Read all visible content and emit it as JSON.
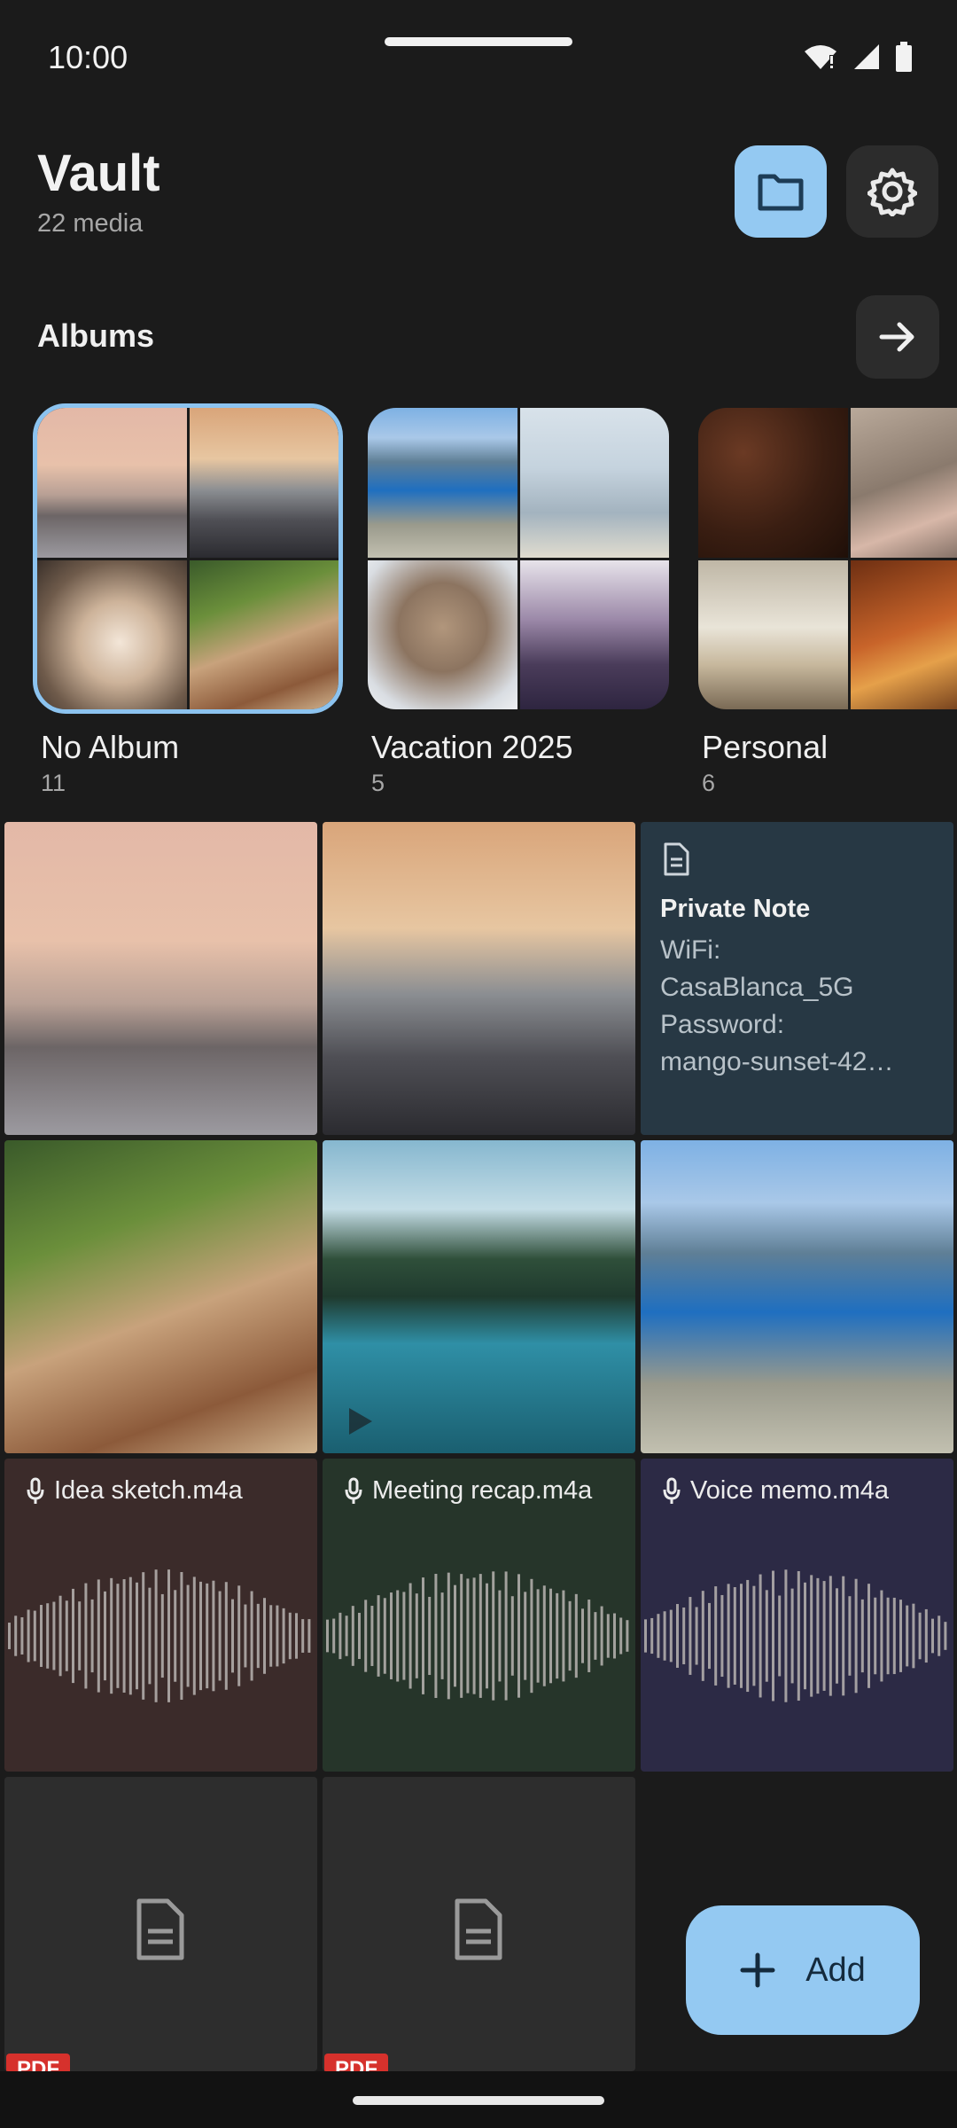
{
  "status_bar": {
    "time": "10:00"
  },
  "header": {
    "title": "Vault",
    "subtitle": "22 media"
  },
  "albums_section": {
    "title": "Albums"
  },
  "albums": [
    {
      "name": "No Album",
      "count": "11"
    },
    {
      "name": "Vacation 2025",
      "count": "5"
    },
    {
      "name": "Personal",
      "count": "6"
    }
  ],
  "note": {
    "title": "Private Note",
    "body": "WiFi:\nCasaBlanca_5G\nPassword:\nmango-sunset-42…"
  },
  "audio": [
    {
      "label": "Idea sketch.m4a",
      "color": "#3b2b2a"
    },
    {
      "label": "Meeting recap.m4a",
      "color": "#26352a"
    },
    {
      "label": "Voice memo.m4a",
      "color": "#2c2a45"
    }
  ],
  "pdf": {
    "badge": "PDF"
  },
  "fab": {
    "label": "Add"
  },
  "colors": {
    "accent": "#94c9f2",
    "background": "#1b1b1b",
    "note_bg": "#273844",
    "pdf_badge": "#d6312c"
  }
}
